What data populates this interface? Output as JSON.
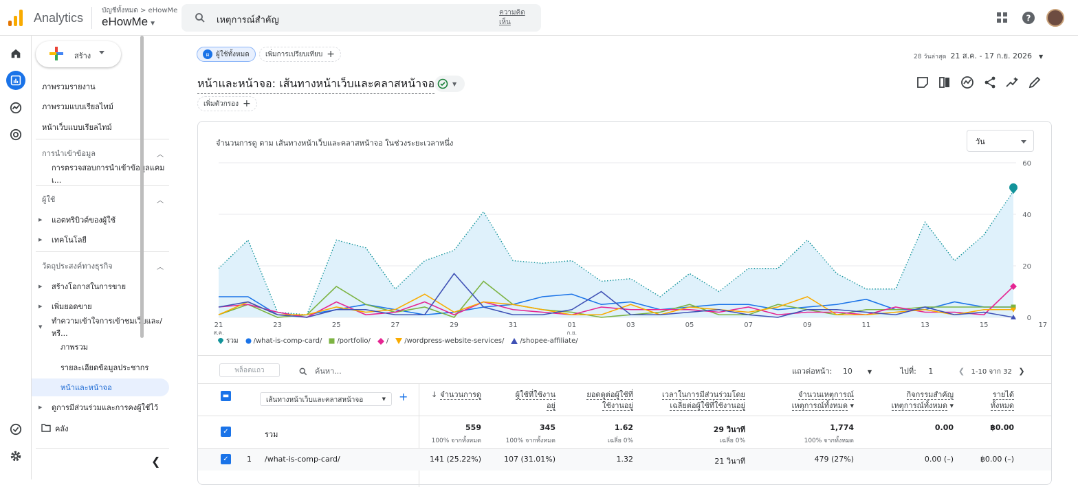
{
  "topbar": {
    "app_name": "Analytics",
    "breadcrumb": "บัญชีทั้งหมด > eHowMe",
    "account": "eHowMe",
    "search_text": "เหตุการณ์สำคัญ",
    "feedback": "ความคิดเห็น"
  },
  "sidebar": {
    "create_label": "สร้าง",
    "items": [
      {
        "label": "ภาพรวมรายงาน"
      },
      {
        "label": "ภาพรวมแบบเรียลไทม์"
      },
      {
        "label": "หน้าเว็บแบบเรียลไทม์"
      }
    ],
    "sections": [
      {
        "label": "การนำเข้าข้อมูล",
        "items": [
          "การตรวจสอบการนำเข้าข้อมูลแคมเ..."
        ]
      },
      {
        "label": "ผู้ใช้",
        "items": [
          "แอตทริบิวต์ของผู้ใช้",
          "เทคโนโลยี"
        ]
      },
      {
        "label": "วัตถุประสงค์ทางธุรกิจ",
        "items": [
          "สร้างโอกาสในการขาย",
          "เพิ่มยอดขาย",
          "ทำความเข้าใจการเข้าชมเว็บและ/หรื..."
        ]
      }
    ],
    "sub_items": [
      "ภาพรวม",
      "รายละเอียดข้อมูลประชากร",
      "หน้าและหน้าจอ"
    ],
    "engagement": "ดูการมีส่วนร่วมและการคงผู้ใช้ไว้",
    "library": "คลัง"
  },
  "toolbar": {
    "segment_initial": "ผ",
    "segment_chip": "ผู้ใช้ทั้งหมด",
    "compare_chip": "เพิ่มการเปรียบเทียบ",
    "date_prefix": "28 วันล่าสุด",
    "date_range": "21 ส.ค. - 17 ก.ย. 2026",
    "report_title": "หน้าและหน้าจอ: เส้นทางหน้าเว็บและคลาสหน้าจอ",
    "filter_chip": "เพิ่มตัวกรอง"
  },
  "chart": {
    "title": "จำนวนการดู ตาม เส้นทางหน้าเว็บและคลาสหน้าจอ ในช่วงระยะเวลาหนึ่ง",
    "granularity": "วัน"
  },
  "chart_data": {
    "type": "line",
    "x_tick_labels": [
      "21 ส.ค.",
      "23",
      "25",
      "27",
      "29",
      "31",
      "01 ก.ย.",
      "03",
      "05",
      "07",
      "09",
      "11",
      "13",
      "15",
      "17"
    ],
    "ylim": [
      0,
      60
    ],
    "y_ticks": [
      0,
      20,
      40,
      60
    ],
    "grid": true,
    "legend_position": "bottom",
    "series": [
      {
        "name": "รวม",
        "color": "#12939a",
        "style": "dotted-area",
        "values": [
          19,
          30,
          2,
          1,
          30,
          27,
          11,
          22,
          26,
          41,
          22,
          21,
          22,
          14,
          15,
          8,
          17,
          10,
          19,
          19,
          30,
          17,
          11,
          11,
          37,
          22,
          32,
          49
        ]
      },
      {
        "name": "/what-is-comp-card/",
        "color": "#1a73e8",
        "values": [
          8,
          8,
          1,
          1,
          3,
          5,
          3,
          1,
          2,
          4,
          5,
          8,
          9,
          5,
          6,
          3,
          4,
          5,
          5,
          3,
          4,
          5,
          7,
          3,
          3,
          6,
          4,
          4
        ]
      },
      {
        "name": "/portfolio/",
        "color": "#7cb342",
        "values": [
          1,
          5,
          0,
          1,
          12,
          5,
          2,
          4,
          0,
          14,
          5,
          3,
          2,
          0,
          1,
          2,
          5,
          1,
          1,
          5,
          3,
          1,
          3,
          3,
          4,
          4,
          4,
          4
        ]
      },
      {
        "name": "/",
        "color": "#e52592",
        "values": [
          4,
          5,
          2,
          0,
          6,
          1,
          2,
          6,
          1,
          6,
          3,
          2,
          1,
          4,
          3,
          3,
          3,
          2,
          4,
          1,
          2,
          2,
          1,
          4,
          2,
          2,
          1,
          12
        ]
      },
      {
        "name": "/wordpress-website-services/",
        "color": "#f9ab00",
        "values": [
          1,
          6,
          1,
          1,
          4,
          2,
          3,
          9,
          2,
          6,
          5,
          3,
          1,
          1,
          5,
          1,
          4,
          3,
          2,
          4,
          8,
          1,
          1,
          2,
          3,
          1,
          3,
          3
        ]
      },
      {
        "name": "/shopee-affiliate/",
        "color": "#3f51b5",
        "values": [
          4,
          6,
          1,
          0,
          3,
          3,
          1,
          1,
          17,
          4,
          1,
          1,
          3,
          10,
          1,
          1,
          2,
          3,
          1,
          0,
          3,
          3,
          2,
          1,
          4,
          1,
          2,
          0
        ]
      }
    ]
  },
  "table_bar": {
    "plot_rows": "พล็อตแถว",
    "search_placeholder": "ค้นหา...",
    "rows_per_page_label": "แถวต่อหน้า:",
    "rows_per_page": "10",
    "goto_label": "ไปที่:",
    "goto_value": "1",
    "range": "1-10 จาก 32"
  },
  "table": {
    "dimension": "เส้นทางหน้าเว็บและคลาสหน้าจอ",
    "columns": [
      {
        "l1": "จำนวนการดู",
        "l2": ""
      },
      {
        "l1": "ผู้ใช้ที่ใช้งาน",
        "l2": "อยู่"
      },
      {
        "l1": "ยอดดูต่อผู้ใช้ที่",
        "l2": "ใช้งานอยู่"
      },
      {
        "l1": "เวลาในการมีส่วนร่วมโดย",
        "l2": "เฉลี่ยต่อผู้ใช้ที่ใช้งานอยู่"
      },
      {
        "l1": "จำนวนเหตุการณ์",
        "l2": "เหตุการณ์ทั้งหมด"
      },
      {
        "l1": "กิจกรรมสำคัญ",
        "l2": "เหตุการณ์ทั้งหมด"
      },
      {
        "l1": "รายได้",
        "l2": "ทั้งหมด"
      }
    ],
    "total": {
      "label": "รวม",
      "values": [
        "559",
        "345",
        "1.62",
        "29 วินาที",
        "1,774",
        "0.00",
        "฿0.00"
      ],
      "subs": [
        "100% จากทั้งหมด",
        "100% จากทั้งหมด",
        "เฉลี่ย 0%",
        "เฉลี่ย 0%",
        "100% จากทั้งหมด",
        "",
        ""
      ]
    },
    "rows": [
      {
        "index": "1",
        "path": "/what-is-comp-card/",
        "values": [
          "141 (25.22%)",
          "107 (31.01%)",
          "1.32",
          "21 วินาที",
          "479 (27%)",
          "0.00 (–)",
          "฿0.00 (–)"
        ]
      }
    ]
  }
}
